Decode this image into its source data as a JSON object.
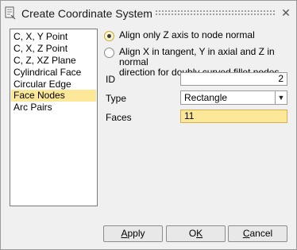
{
  "window": {
    "title": "Create Coordinate System",
    "close_glyph": "✕"
  },
  "methods": {
    "items": [
      "C, X, Y Point",
      "C, X, Z Point",
      "C, Z, XZ Plane",
      "Cylindrical Face",
      "Circular Edge",
      "Face Nodes",
      "Arc Pairs"
    ],
    "selected": "Face Nodes"
  },
  "options": {
    "radio1_label": "Align only Z axis to node normal",
    "radio1_checked": true,
    "radio2_label_line1": "Align X in tangent, Y in axial and Z in normal",
    "radio2_label_line2": "direction for doubly curved fillet nodes",
    "radio2_checked": false
  },
  "fields": {
    "id_label": "ID",
    "id_value": "2",
    "type_label": "Type",
    "type_value": "Rectangle",
    "faces_label": "Faces",
    "faces_value": "11"
  },
  "buttons": {
    "apply_mnemonic": "A",
    "apply_rest": "pply",
    "ok_first": "O",
    "ok_mnemonic": "K",
    "cancel_mnemonic": "C",
    "cancel_rest": "ancel"
  },
  "colors": {
    "selection_highlight": "#fde89a",
    "dialog_background": "#f0f0f0"
  }
}
